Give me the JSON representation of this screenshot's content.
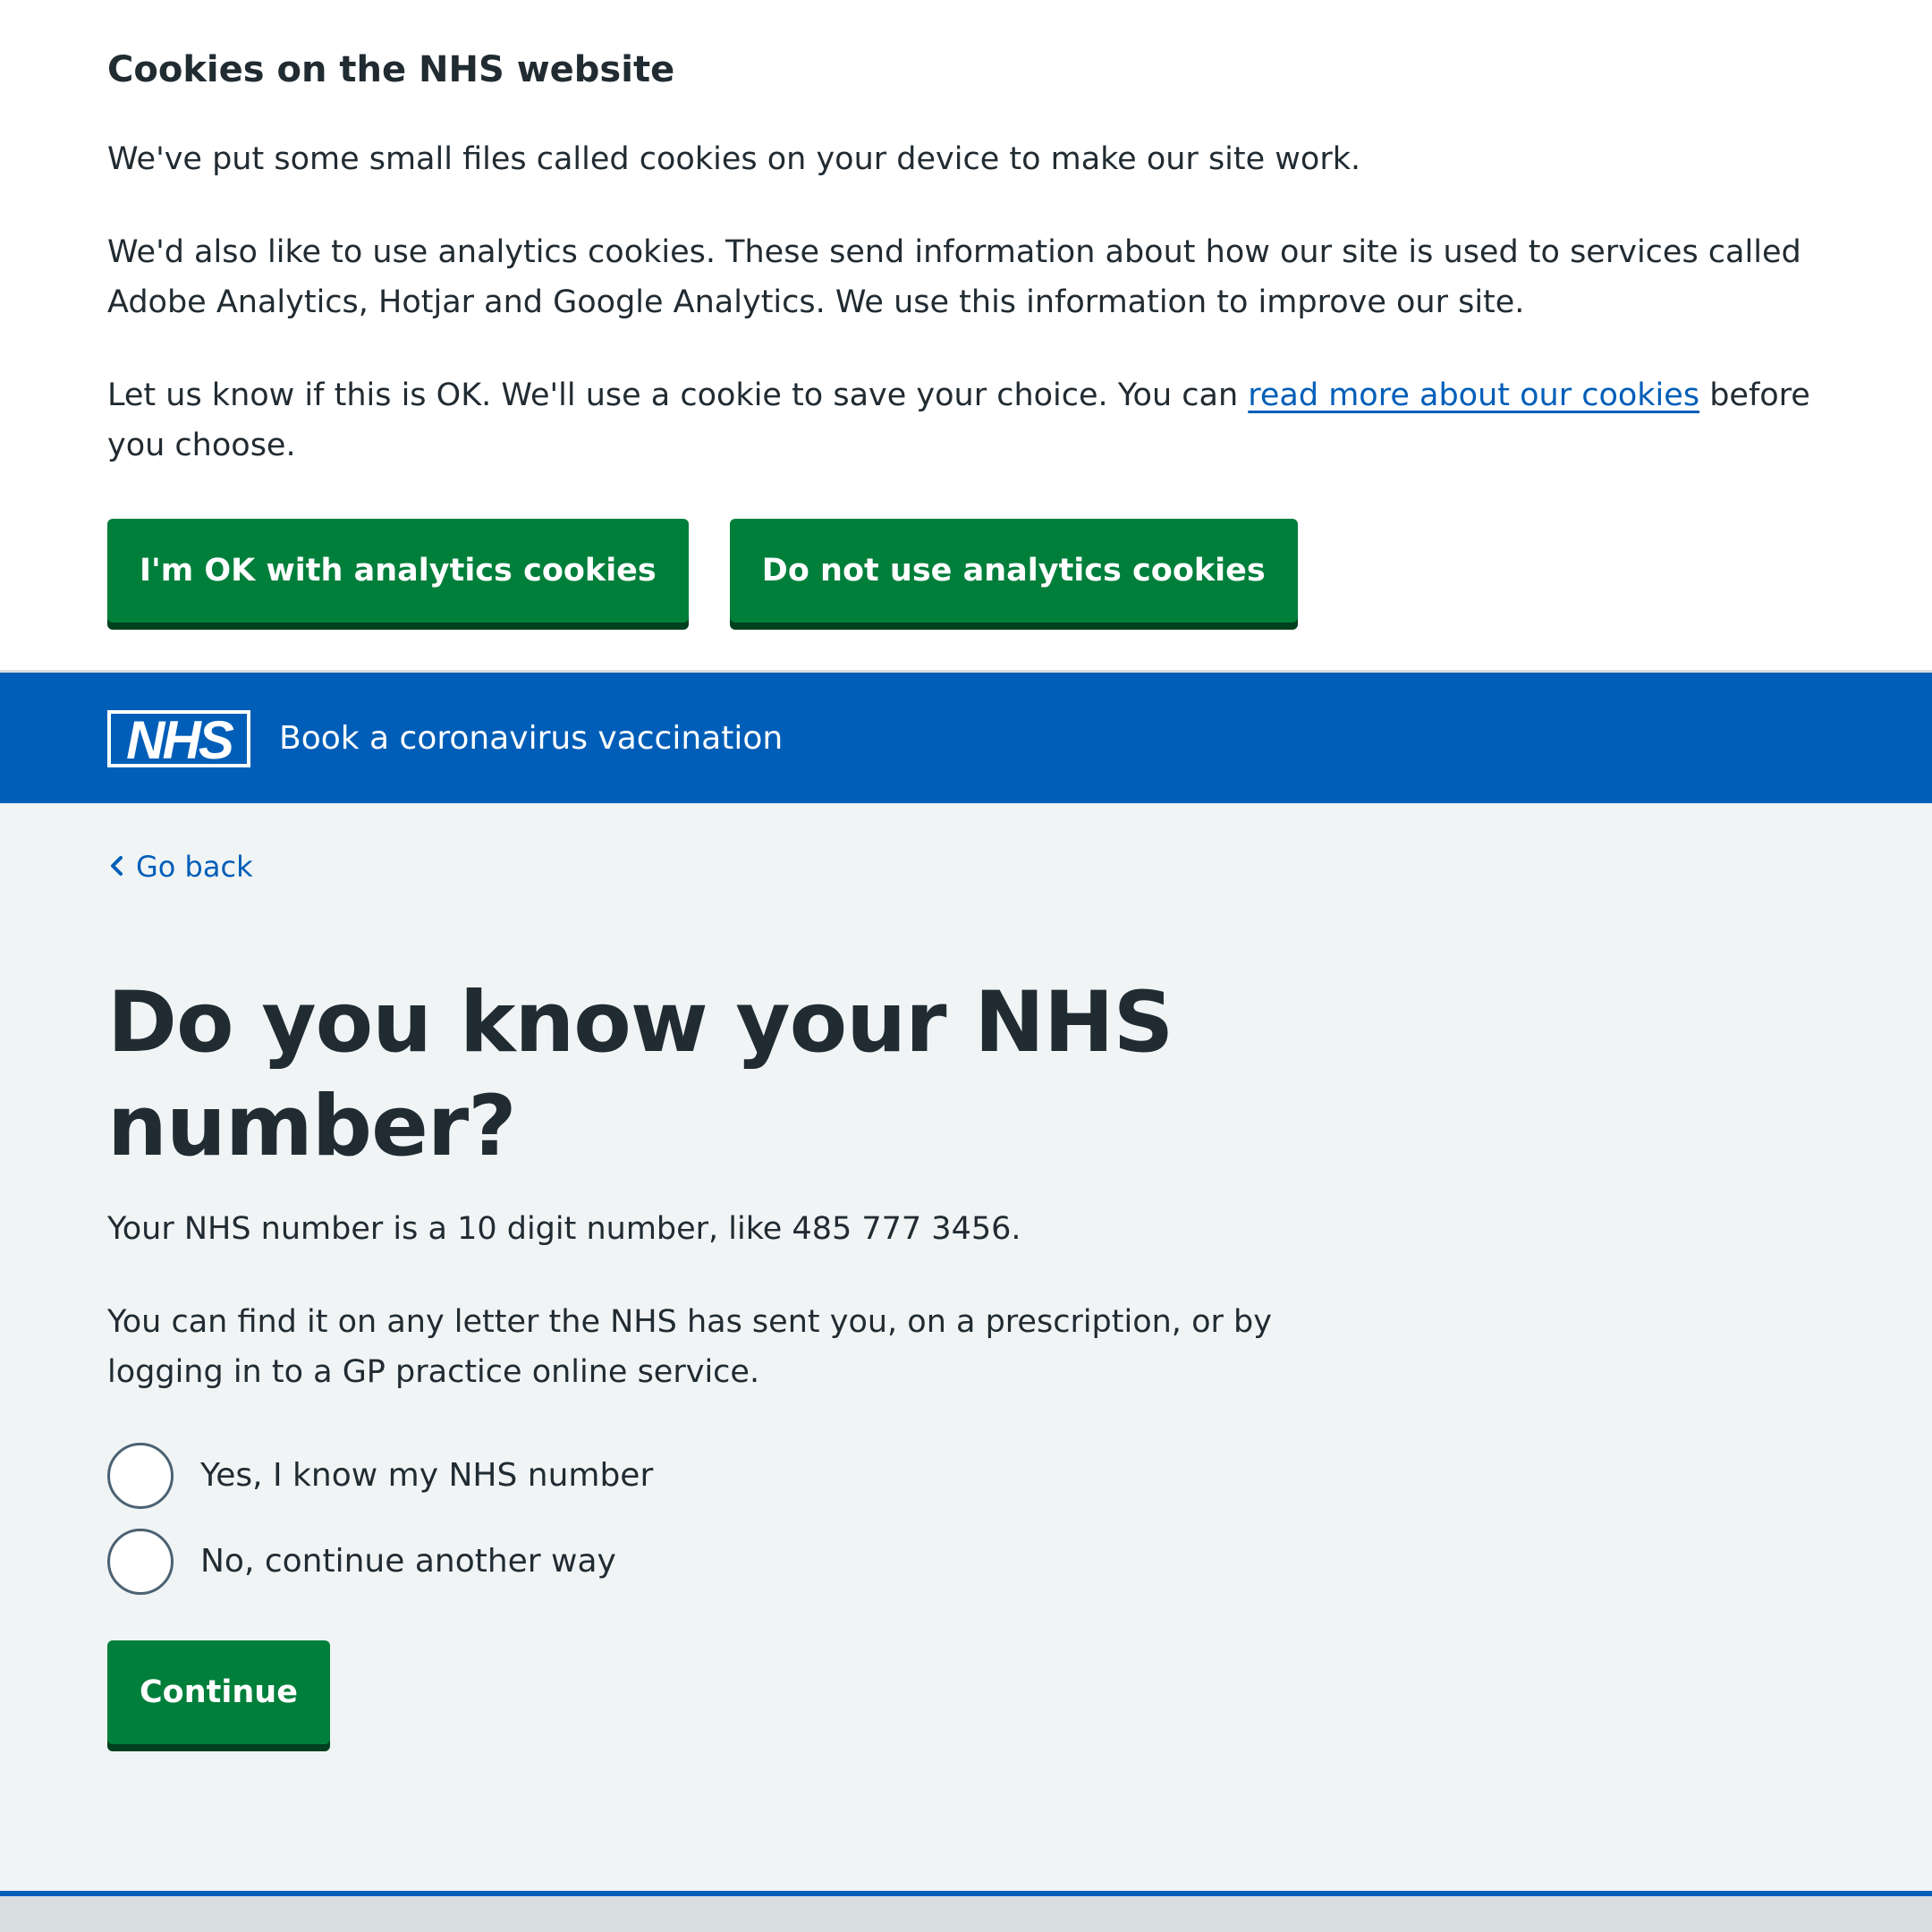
{
  "cookie_banner": {
    "title": "Cookies on the NHS website",
    "paragraph_1": "We've put some small files called cookies on your device to make our site work.",
    "paragraph_2": "We'd also like to use analytics cookies. These send information about how our site is used to services called Adobe Analytics, Hotjar and Google Analytics. We use this information to improve our site.",
    "paragraph_3_before_link": "Let us know if this is OK. We'll use a cookie to save your choice. You can ",
    "link_text": "read more about our cookies",
    "paragraph_3_after_link": " before you choose.",
    "accept_button": "I'm OK with analytics cookies",
    "reject_button": "Do not use analytics cookies"
  },
  "header": {
    "logo_text": "NHS",
    "service_name": "Book a coronavirus vaccination"
  },
  "main": {
    "back_link": "Go back",
    "title": "Do you know your NHS number?",
    "hint_1": "Your NHS number is a 10 digit number, like 485 777 3456.",
    "hint_2": "You can find it on any letter the NHS has sent you, on a prescription, or by logging in to a GP practice online service.",
    "options": [
      {
        "label": "Yes, I know my NHS number",
        "selected": false
      },
      {
        "label": "No, continue another way",
        "selected": false
      }
    ],
    "continue_button": "Continue"
  },
  "icons": {
    "logo": "nhs-logo",
    "back": "chevron-left-icon"
  },
  "colors": {
    "nhs_blue": "#005eb8",
    "button_green": "#007f3b",
    "button_shadow": "#00401e",
    "text": "#212b32",
    "page_background": "#f0f4f5"
  }
}
